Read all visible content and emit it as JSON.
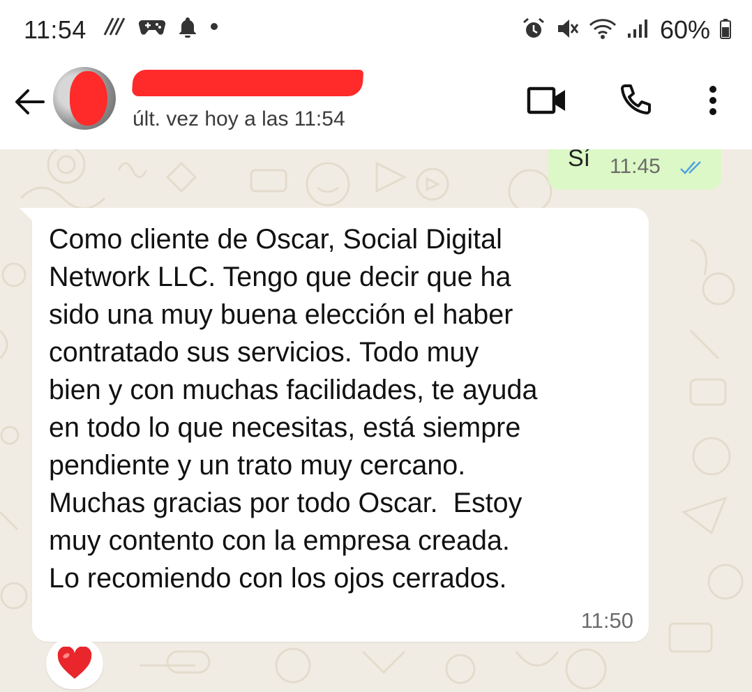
{
  "status_bar": {
    "time": "11:54",
    "battery_percent": "60%",
    "left_icons": [
      "data-saver-icon",
      "game-controller-icon",
      "bell-icon",
      "dot-icon"
    ],
    "right_icons": [
      "alarm-icon",
      "mute-icon",
      "wifi-icon",
      "signal-icon",
      "battery-icon"
    ]
  },
  "header": {
    "contact_name": "",
    "last_seen": "últ. vez hoy a las 11:54",
    "icons": [
      "back-arrow-icon",
      "video-call-icon",
      "phone-icon",
      "more-options-icon"
    ]
  },
  "messages": {
    "outgoing": {
      "text": "Sí",
      "time": "11:45",
      "status": "read"
    },
    "incoming": {
      "text": "Como cliente de Oscar, Social Digital\nNetwork LLC. Tengo que decir que ha\nsido una muy buena elección el haber\ncontratado sus servicios. Todo muy\nbien y con muchas facilidades, te ayuda\nen todo lo que necesitas, está siempre\npendiente y un trato muy cercano.\nMuchas gracias por todo Oscar.  Estoy\nmuy contento con la empresa creada.\nLo recomiendo con los ojos cerrados.",
      "time": "11:50",
      "reaction": "❤️"
    }
  },
  "colors": {
    "chat_background": "#f1ece3",
    "outgoing_bubble": "#dcf8c6",
    "incoming_bubble": "#ffffff",
    "read_ticks": "#4fa3e0",
    "redaction": "#ff2a2a"
  }
}
